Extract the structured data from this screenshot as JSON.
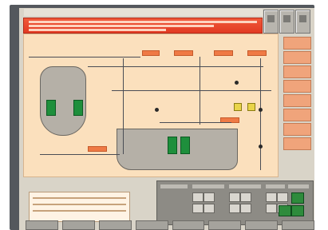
{
  "window": {
    "menu": [],
    "alarm_lines": 3
  },
  "toolbar": {
    "buttons": [
      {
        "icon": "gear-icon"
      },
      {
        "icon": "document-icon"
      },
      {
        "icon": "settings-icon"
      }
    ]
  },
  "side_nav": [
    {
      "label": ""
    },
    {
      "label": ""
    },
    {
      "label": ""
    },
    {
      "label": ""
    },
    {
      "label": ""
    },
    {
      "label": ""
    },
    {
      "label": ""
    },
    {
      "label": ""
    }
  ],
  "process": {
    "tags": [],
    "orange_tags": 6,
    "valves": 6
  },
  "control_panel": {
    "sections": [],
    "green_buttons": 3
  },
  "bottom_bar": {
    "buttons": [
      {
        "label": ""
      },
      {
        "label": ""
      },
      {
        "label": ""
      },
      {
        "label": ""
      },
      {
        "label": ""
      },
      {
        "label": ""
      },
      {
        "label": ""
      },
      {
        "label": ""
      }
    ]
  },
  "colors": {
    "alarm_red": "#e23a23",
    "canvas_bg": "#fbe0bd",
    "accent_green": "#1e8f3c",
    "panel_gray": "#8d8b85"
  }
}
